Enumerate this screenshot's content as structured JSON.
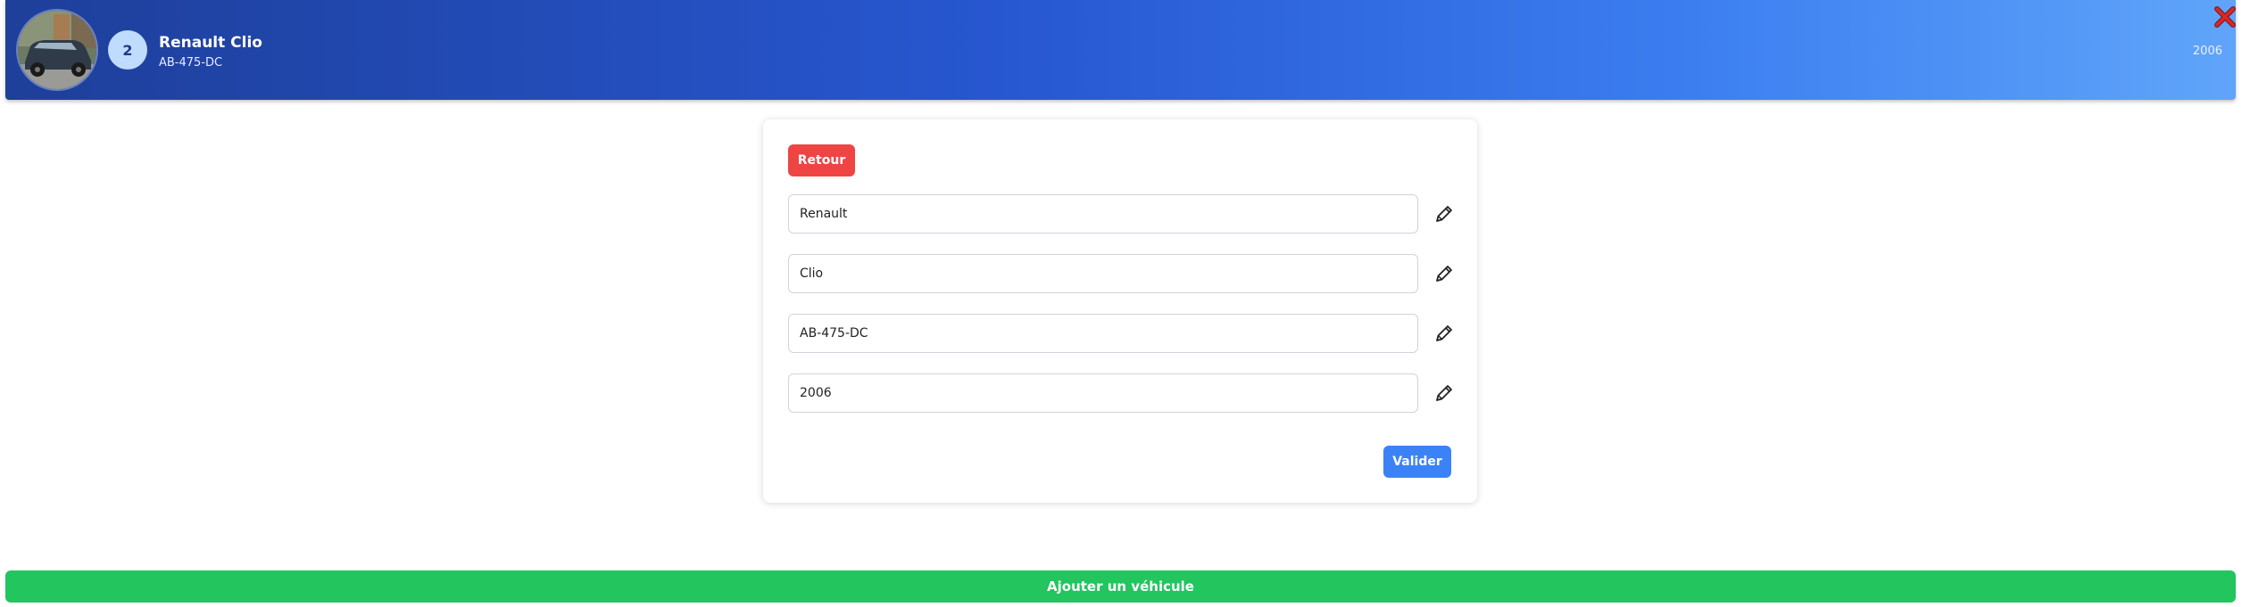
{
  "header": {
    "vehicle_image": "car-photo",
    "index_badge": "2",
    "title": "Renault Clio",
    "plate": "AB-475-DC",
    "year": "2006",
    "close_icon": "close-x-icon"
  },
  "form": {
    "back_label": "Retour",
    "fields": [
      {
        "value": "Renault"
      },
      {
        "value": "Clio"
      },
      {
        "value": "AB-475-DC"
      },
      {
        "value": "2006"
      }
    ],
    "edit_icon": "pencil-icon",
    "submit_label": "Valider"
  },
  "footer": {
    "add_label": "Ajouter un véhicule"
  },
  "colors": {
    "header_gradient_start": "#1e3f9a",
    "header_gradient_end": "#60a5fa",
    "back_button": "#ef4444",
    "submit_button": "#3b82f6",
    "add_button": "#22c55e",
    "close_icon": "#dc2626"
  }
}
